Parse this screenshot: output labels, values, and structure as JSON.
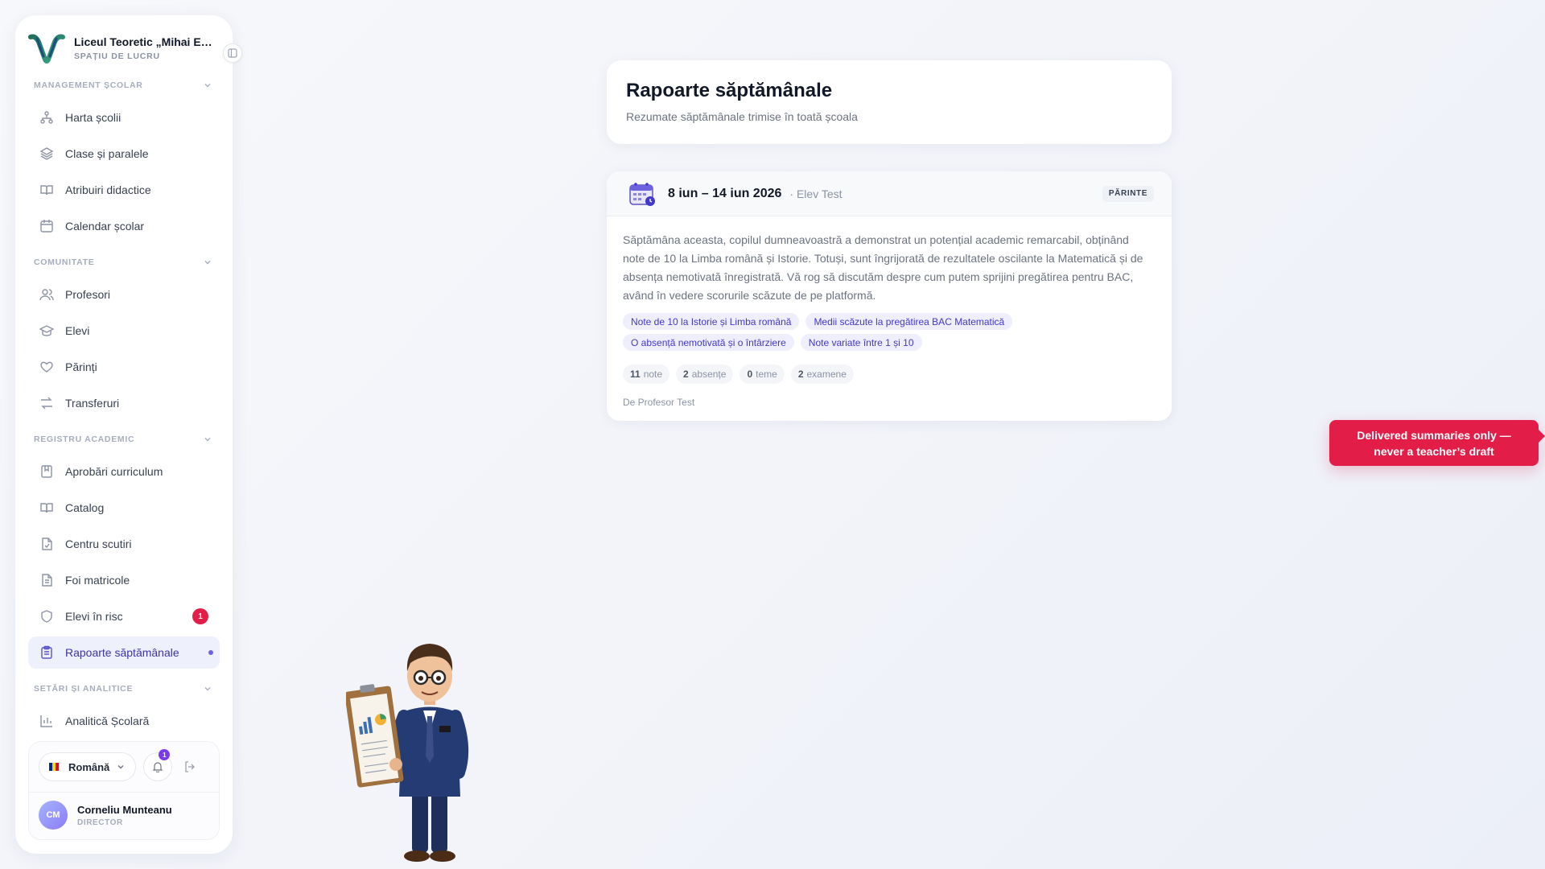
{
  "sidebar": {
    "school_name": "Liceul Teoretic „Mihai Emi...",
    "workspace_label": "SPAȚIU DE LUCRU",
    "sections": [
      {
        "title": "MANAGEMENT ȘCOLAR",
        "items": [
          {
            "label": "Harta școlii",
            "icon": "sitemap-icon"
          },
          {
            "label": "Clase și paralele",
            "icon": "layers-icon"
          },
          {
            "label": "Atribuiri didactice",
            "icon": "book-open-icon"
          },
          {
            "label": "Calendar școlar",
            "icon": "calendar-icon"
          }
        ]
      },
      {
        "title": "COMUNITATE",
        "items": [
          {
            "label": "Profesori",
            "icon": "users-icon"
          },
          {
            "label": "Elevi",
            "icon": "graduation-cap-icon"
          },
          {
            "label": "Părinți",
            "icon": "heart-icon"
          },
          {
            "label": "Transferuri",
            "icon": "arrows-swap-icon"
          }
        ]
      },
      {
        "title": "REGISTRU ACADEMIC",
        "items": [
          {
            "label": "Aprobări curriculum",
            "icon": "bookmark-icon"
          },
          {
            "label": "Catalog",
            "icon": "book-open-icon"
          },
          {
            "label": "Centru scutiri",
            "icon": "file-check-icon"
          },
          {
            "label": "Foi matricole",
            "icon": "file-text-icon"
          },
          {
            "label": "Elevi în risc",
            "icon": "shield-icon",
            "badge": "1"
          },
          {
            "label": "Rapoarte săptămânale",
            "icon": "clipboard-icon",
            "active": true
          }
        ]
      },
      {
        "title": "SETĂRI ȘI ANALITICE",
        "items": [
          {
            "label": "Analitică Școlară",
            "icon": "bar-chart-icon"
          }
        ]
      }
    ],
    "footer": {
      "language": "Română",
      "notifications_count": "1",
      "user_initials": "CM",
      "user_name": "Corneliu Munteanu",
      "user_role": "DIRECTOR"
    }
  },
  "header": {
    "title": "Rapoarte săptămânale",
    "subtitle": "Rezumate săptămânale trimise în toată școala"
  },
  "report": {
    "week": "8 iun – 14 iun 2026",
    "student": "· Elev Test",
    "audience": "PĂRINTE",
    "summary": "Săptămâna aceasta, copilul dumneavoastră a demonstrat un potențial academic remarcabil, obținând note de 10 la Limba română și Istorie. Totuși, sunt îngrijorată de rezultatele oscilante la Matematică și de absența nemotivată înregistrată. Vă rog să discutăm despre cum putem sprijini pregătirea pentru BAC, având în vedere scorurile scăzute de pe platformă.",
    "tags": [
      "Note de 10 la Istorie și Limba română",
      "Medii scăzute la pregătirea BAC Matematică",
      "O absență nemotivată și o întârziere",
      "Note variate între 1 și 10"
    ],
    "stats": [
      {
        "value": "11",
        "label": "note"
      },
      {
        "value": "2",
        "label": "absențe"
      },
      {
        "value": "0",
        "label": "teme"
      },
      {
        "value": "2",
        "label": "examene"
      }
    ],
    "author": "De Profesor Test"
  },
  "tooltip": {
    "line1": "Delivered summaries only —",
    "line2": "never a teacher’s draft"
  },
  "colors": {
    "accent": "#4338ca",
    "alert": "#e11d48",
    "active_bg": "#eef0fb"
  }
}
